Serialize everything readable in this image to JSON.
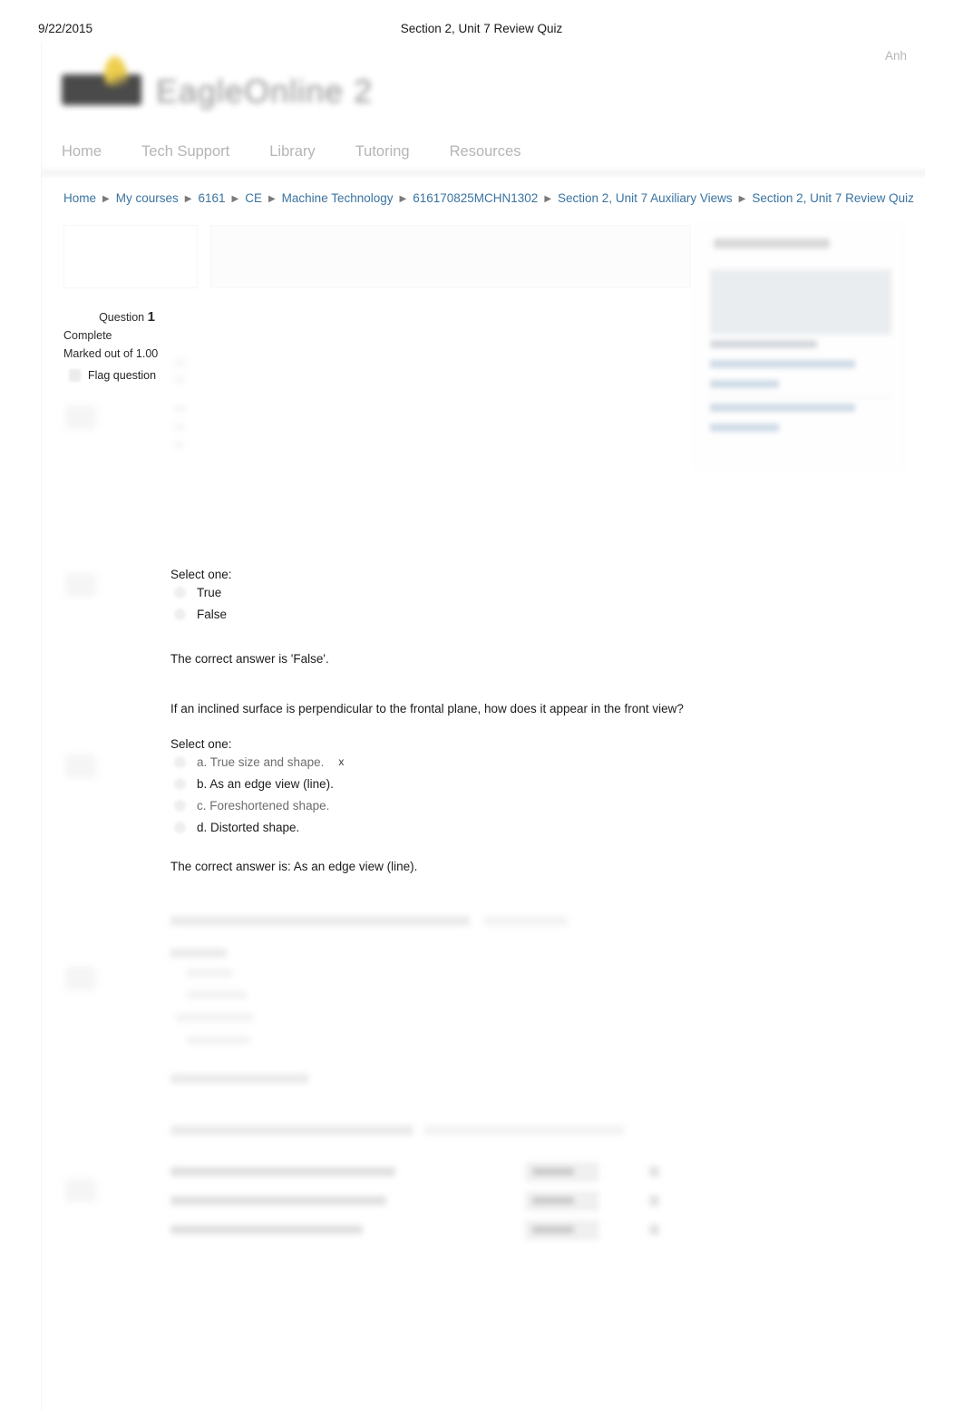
{
  "print_header": {
    "date": "9/22/2015",
    "title": "Section 2, Unit 7  Review Quiz"
  },
  "account": {
    "user_label": "Anh"
  },
  "brand": {
    "logo_text": "EagleOnline 2",
    "flame_color": "#e9c73c",
    "mark_color": "#3b3b3b"
  },
  "top_nav": {
    "items": [
      {
        "label": "Home"
      },
      {
        "label": "Tech Support"
      },
      {
        "label": "Library"
      },
      {
        "label": "Tutoring"
      },
      {
        "label": "Resources"
      }
    ],
    "link_color": "#b5b5b5"
  },
  "breadcrumb": {
    "separator": "▶",
    "link_color": "#3a73a0",
    "items": [
      {
        "label": "Home"
      },
      {
        "label": "My courses"
      },
      {
        "label": "6161"
      },
      {
        "label": "CE"
      },
      {
        "label": "Machine Technology"
      },
      {
        "label": "616170825MCHN1302"
      },
      {
        "label": "Section 2, Unit 7  Auxiliary Views"
      },
      {
        "label": "Section 2, Unit 7  Review Quiz"
      }
    ]
  },
  "question_meta": {
    "question_word": "Question",
    "question_number": "1",
    "state": "Complete",
    "marks": "Marked out of 1.00",
    "flag_label": "Flag question"
  },
  "questions": [
    {
      "id": "q1",
      "stem": "",
      "select_prompt": "Select one:",
      "options": [
        {
          "label": "True",
          "dim": false,
          "marker": ""
        },
        {
          "label": "False",
          "dim": false,
          "marker": ""
        }
      ],
      "feedback": "The correct answer is 'False'."
    },
    {
      "id": "q2",
      "stem": "If an inclined surface is perpendicular to the frontal plane, how does it appear in the front view?",
      "select_prompt": "Select one:",
      "options": [
        {
          "label": "a. True size and shape.",
          "dim": true,
          "marker": "x"
        },
        {
          "label": "b. As an edge view (line).",
          "dim": false,
          "marker": ""
        },
        {
          "label": "c. Foreshortened shape.",
          "dim": true,
          "marker": ""
        },
        {
          "label": "d. Distorted shape.",
          "dim": false,
          "marker": ""
        }
      ],
      "feedback": "The correct answer is: As an edge view (line)."
    }
  ],
  "obscured": {
    "note": "Regions rendered blurred/illegible in the source screenshot",
    "sidebar_block": true,
    "question_3_block": true,
    "question_4_matching_table": true
  }
}
